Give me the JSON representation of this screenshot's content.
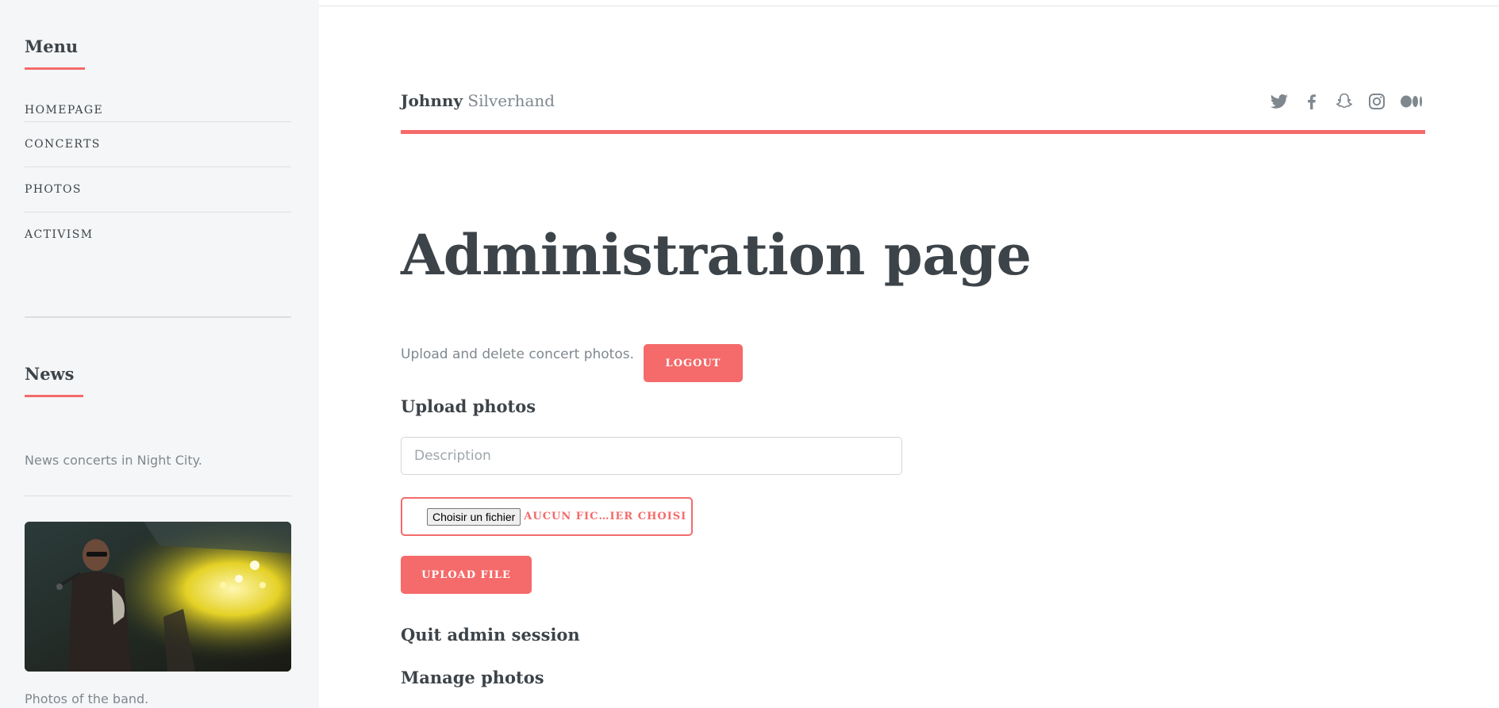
{
  "sidebar": {
    "menu_heading": "Menu",
    "menu_items": [
      {
        "label": "HOMEPAGE"
      },
      {
        "label": "CONCERTS"
      },
      {
        "label": "PHOTOS"
      },
      {
        "label": "ACTIVISM"
      }
    ],
    "news_heading": "News",
    "news_text": "News concerts in Night City.",
    "photo_caption": "Photos of the band."
  },
  "header": {
    "brand_first": "Johnny",
    "brand_last": "Silverhand",
    "social_icons": [
      "twitter-icon",
      "facebook-icon",
      "snapchat-icon",
      "instagram-icon",
      "medium-icon"
    ]
  },
  "main": {
    "title": "Administration page",
    "intro": "Upload and delete concert photos.",
    "logout_label": "LOGOUT",
    "upload_heading": "Upload photos",
    "description_placeholder": "Description",
    "file_button_label": "Choisir un fichier",
    "file_status": "AUCUN FIC…IER CHOISI",
    "upload_button_label": "UPLOAD FILE",
    "quit_heading": "Quit admin session",
    "manage_heading": "Manage photos"
  },
  "colors": {
    "accent": "#f56a6a",
    "text": "#3d4449",
    "muted": "#7f888f",
    "sidebar_bg": "#f5f6f7"
  }
}
